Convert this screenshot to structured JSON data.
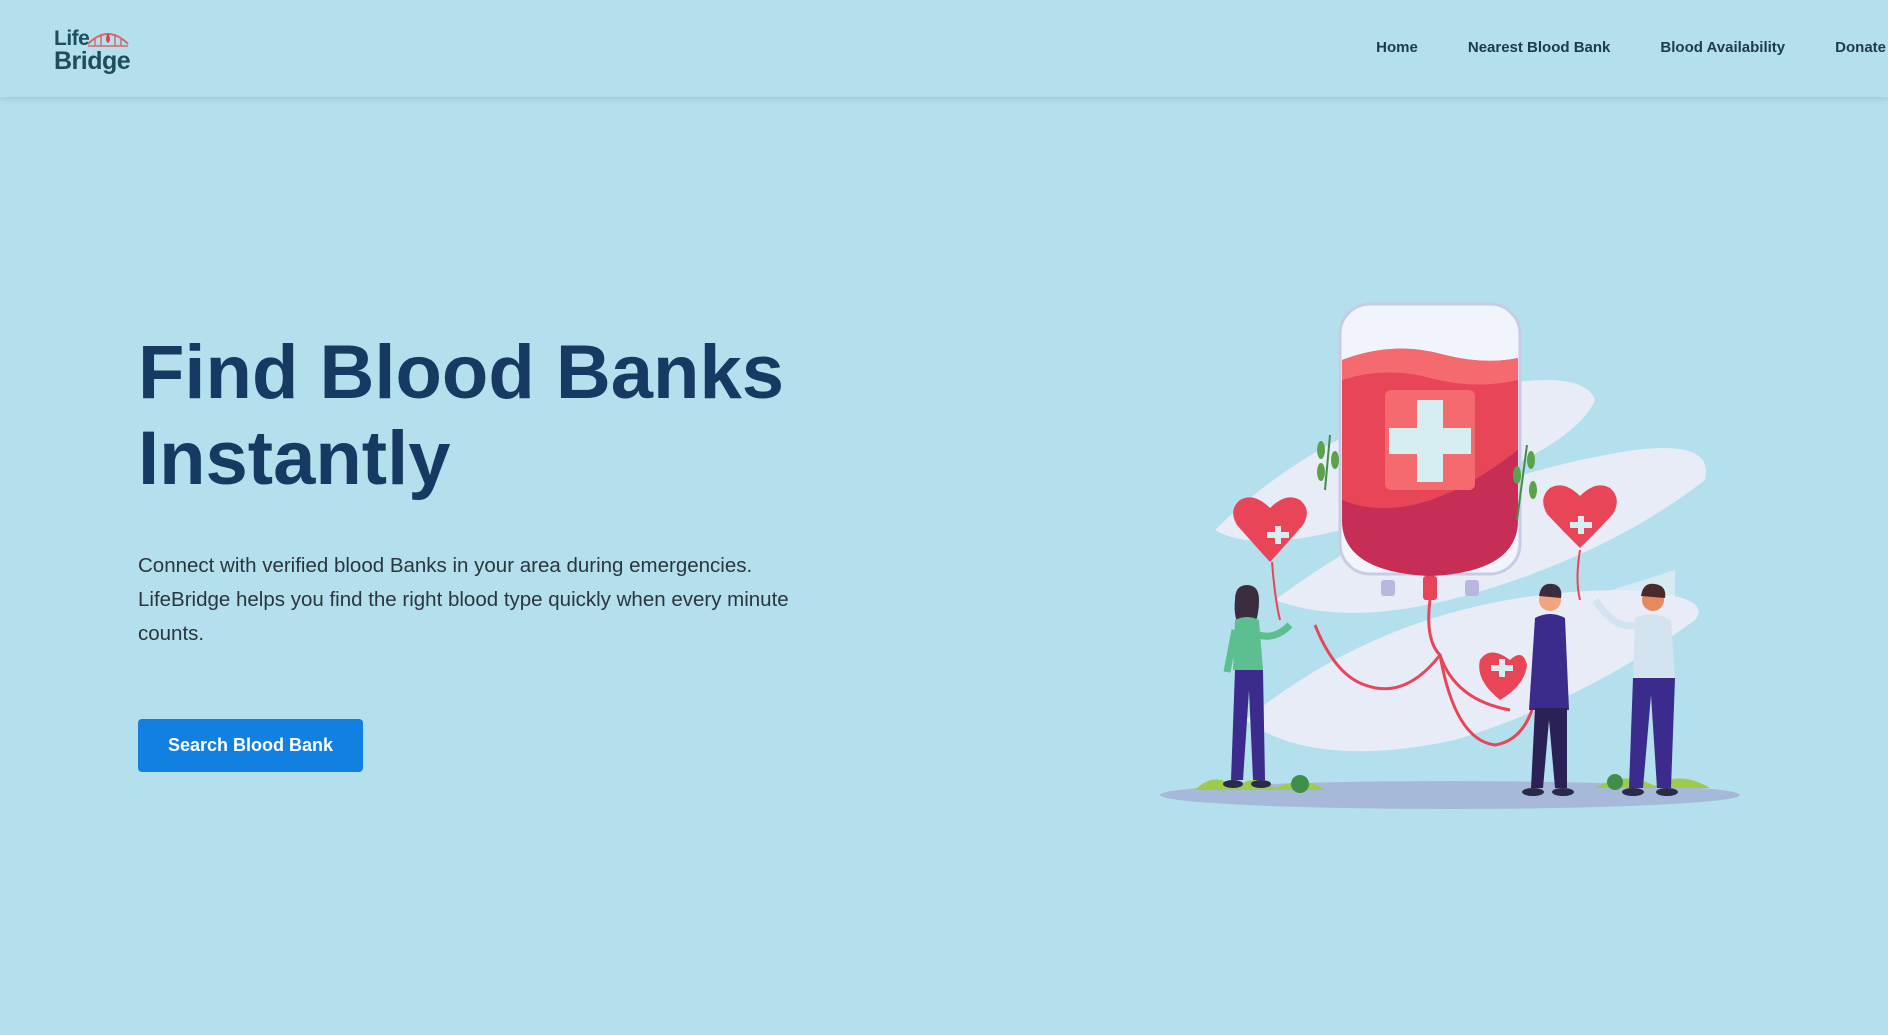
{
  "brand": {
    "logo_line1": "Life",
    "logo_line2": "Bridge",
    "accent_color": "#1280e0",
    "title_color": "#173a63",
    "background_color": "#b3e0ec"
  },
  "nav": {
    "items": [
      {
        "label": "Home"
      },
      {
        "label": "Nearest Blood Bank"
      },
      {
        "label": "Blood Availability"
      },
      {
        "label": "Donate"
      }
    ]
  },
  "hero": {
    "title_line1": "Find Blood Banks",
    "title_line2": "Instantly",
    "description": "Connect with verified blood Banks in your area during emergencies. LifeBridge helps you find the right blood type quickly when every minute counts.",
    "cta_label": "Search Blood Bank"
  },
  "illustration": {
    "icon": "blood-donation-illustration",
    "elements": [
      "blood-bag-icon",
      "heart-balloon-icon",
      "person-icon",
      "plant-icon",
      "medical-cross-icon"
    ]
  }
}
